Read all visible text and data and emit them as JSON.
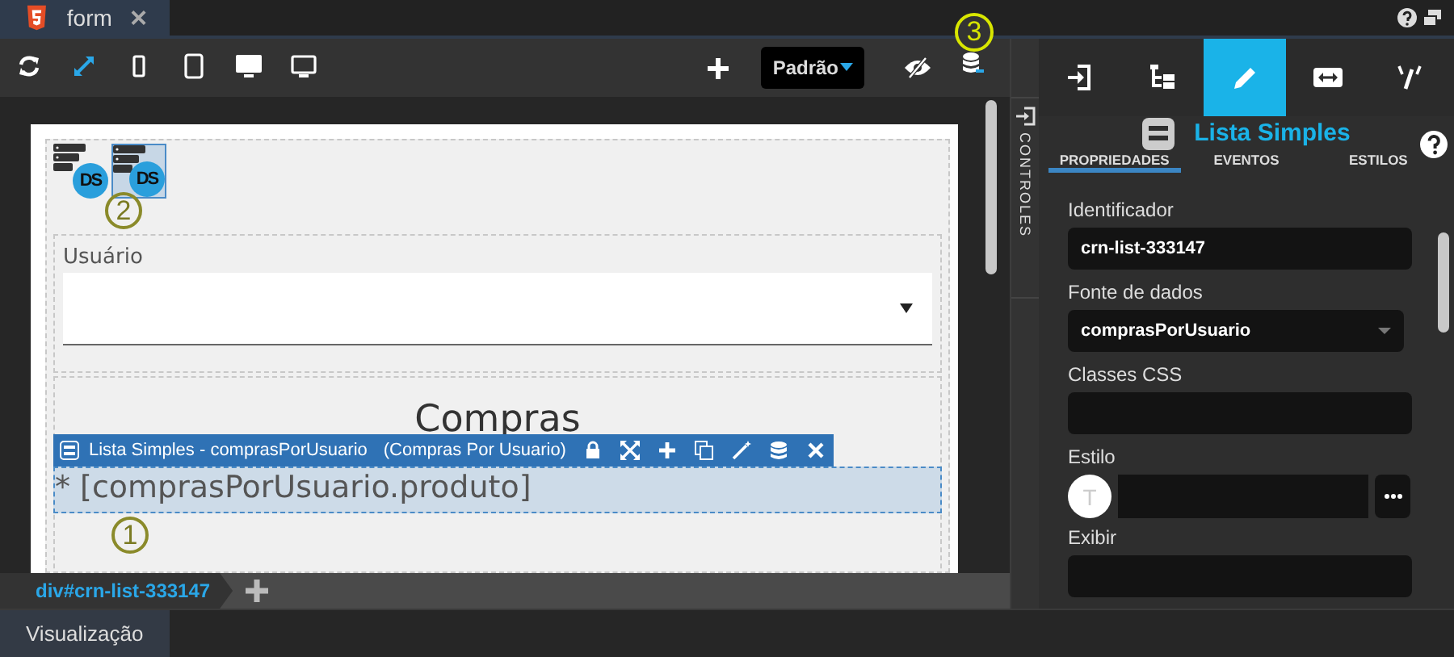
{
  "file_tabs": [
    {
      "label": "form",
      "selected": true
    }
  ],
  "editor_toolbar": {
    "tools": [
      {
        "kind": "refresh",
        "selected": false
      },
      {
        "kind": "fit",
        "selected": true
      },
      {
        "kind": "phone",
        "selected": false
      },
      {
        "kind": "tablet",
        "selected": false
      },
      {
        "kind": "desktop",
        "selected": false
      },
      {
        "kind": "monitor",
        "selected": false
      }
    ],
    "style_dropdown": "Padrão",
    "annotation": "3"
  },
  "canvas": {
    "datasources": [
      {
        "label": "DS",
        "selected": false
      },
      {
        "label": "DS",
        "selected": true
      }
    ],
    "datasource_annotation": "2",
    "select_field": {
      "label": "Usuário"
    },
    "heading": "Compras",
    "component_toolbar": {
      "title": "Lista Simples - comprasPorUsuario",
      "subtitle": "(Compras Por Usuario)"
    },
    "list_item": "* [comprasPorUsuario.produto]",
    "list_annotation": "1"
  },
  "side_strip": {
    "label": "CONTROLES"
  },
  "breadcrumb": {
    "path": "div#crn-list-333147"
  },
  "bottom_tabs": [
    {
      "label": "Visualização",
      "selected": true
    }
  ],
  "panel": {
    "tool_tabs": [
      {
        "kind": "enter",
        "selected": false
      },
      {
        "kind": "tree",
        "selected": false
      },
      {
        "kind": "pencil",
        "selected": true
      },
      {
        "kind": "resize",
        "selected": false
      },
      {
        "kind": "wand",
        "selected": false
      }
    ],
    "title": "Lista Simples",
    "tabs": [
      {
        "label": "PROPRIEDADES",
        "selected": true
      },
      {
        "label": "EVENTOS",
        "selected": false
      },
      {
        "label": "ESTILOS",
        "selected": false
      }
    ],
    "fields": [
      {
        "kind": "text",
        "label": "Identificador",
        "value": "crn-list-333147"
      },
      {
        "kind": "select",
        "label": "Fonte de dados",
        "value": "comprasPorUsuario"
      },
      {
        "kind": "text",
        "label": "Classes CSS"
      },
      {
        "kind": "style",
        "label": "Estilo",
        "avatar": "T"
      },
      {
        "kind": "text",
        "label": "Exibir"
      }
    ]
  }
}
